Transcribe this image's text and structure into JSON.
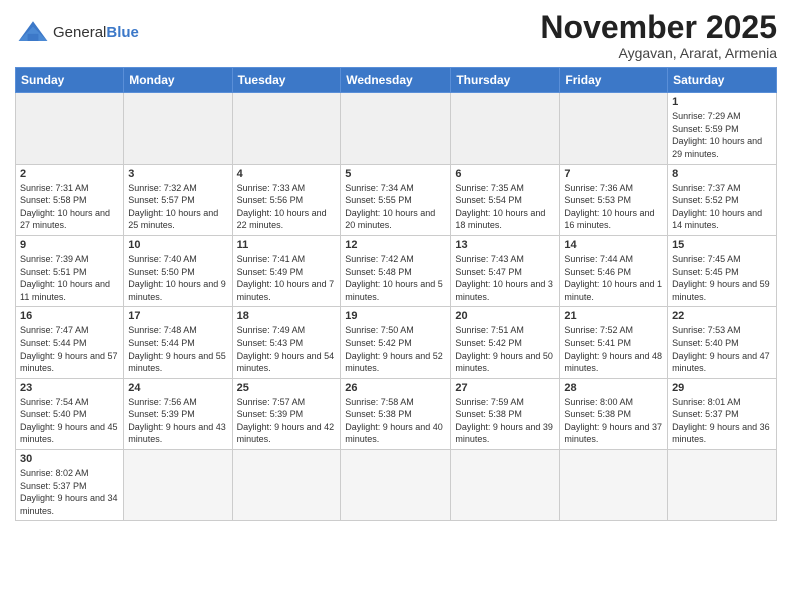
{
  "logo": {
    "text_general": "General",
    "text_blue": "Blue"
  },
  "title": "November 2025",
  "subtitle": "Aygavan, Ararat, Armenia",
  "weekdays": [
    "Sunday",
    "Monday",
    "Tuesday",
    "Wednesday",
    "Thursday",
    "Friday",
    "Saturday"
  ],
  "weeks": [
    [
      {
        "day": "",
        "info": ""
      },
      {
        "day": "",
        "info": ""
      },
      {
        "day": "",
        "info": ""
      },
      {
        "day": "",
        "info": ""
      },
      {
        "day": "",
        "info": ""
      },
      {
        "day": "",
        "info": ""
      },
      {
        "day": "1",
        "info": "Sunrise: 7:29 AM\nSunset: 5:59 PM\nDaylight: 10 hours and 29 minutes."
      }
    ],
    [
      {
        "day": "2",
        "info": "Sunrise: 7:31 AM\nSunset: 5:58 PM\nDaylight: 10 hours and 27 minutes."
      },
      {
        "day": "3",
        "info": "Sunrise: 7:32 AM\nSunset: 5:57 PM\nDaylight: 10 hours and 25 minutes."
      },
      {
        "day": "4",
        "info": "Sunrise: 7:33 AM\nSunset: 5:56 PM\nDaylight: 10 hours and 22 minutes."
      },
      {
        "day": "5",
        "info": "Sunrise: 7:34 AM\nSunset: 5:55 PM\nDaylight: 10 hours and 20 minutes."
      },
      {
        "day": "6",
        "info": "Sunrise: 7:35 AM\nSunset: 5:54 PM\nDaylight: 10 hours and 18 minutes."
      },
      {
        "day": "7",
        "info": "Sunrise: 7:36 AM\nSunset: 5:53 PM\nDaylight: 10 hours and 16 minutes."
      },
      {
        "day": "8",
        "info": "Sunrise: 7:37 AM\nSunset: 5:52 PM\nDaylight: 10 hours and 14 minutes."
      }
    ],
    [
      {
        "day": "9",
        "info": "Sunrise: 7:39 AM\nSunset: 5:51 PM\nDaylight: 10 hours and 11 minutes."
      },
      {
        "day": "10",
        "info": "Sunrise: 7:40 AM\nSunset: 5:50 PM\nDaylight: 10 hours and 9 minutes."
      },
      {
        "day": "11",
        "info": "Sunrise: 7:41 AM\nSunset: 5:49 PM\nDaylight: 10 hours and 7 minutes."
      },
      {
        "day": "12",
        "info": "Sunrise: 7:42 AM\nSunset: 5:48 PM\nDaylight: 10 hours and 5 minutes."
      },
      {
        "day": "13",
        "info": "Sunrise: 7:43 AM\nSunset: 5:47 PM\nDaylight: 10 hours and 3 minutes."
      },
      {
        "day": "14",
        "info": "Sunrise: 7:44 AM\nSunset: 5:46 PM\nDaylight: 10 hours and 1 minute."
      },
      {
        "day": "15",
        "info": "Sunrise: 7:45 AM\nSunset: 5:45 PM\nDaylight: 9 hours and 59 minutes."
      }
    ],
    [
      {
        "day": "16",
        "info": "Sunrise: 7:47 AM\nSunset: 5:44 PM\nDaylight: 9 hours and 57 minutes."
      },
      {
        "day": "17",
        "info": "Sunrise: 7:48 AM\nSunset: 5:44 PM\nDaylight: 9 hours and 55 minutes."
      },
      {
        "day": "18",
        "info": "Sunrise: 7:49 AM\nSunset: 5:43 PM\nDaylight: 9 hours and 54 minutes."
      },
      {
        "day": "19",
        "info": "Sunrise: 7:50 AM\nSunset: 5:42 PM\nDaylight: 9 hours and 52 minutes."
      },
      {
        "day": "20",
        "info": "Sunrise: 7:51 AM\nSunset: 5:42 PM\nDaylight: 9 hours and 50 minutes."
      },
      {
        "day": "21",
        "info": "Sunrise: 7:52 AM\nSunset: 5:41 PM\nDaylight: 9 hours and 48 minutes."
      },
      {
        "day": "22",
        "info": "Sunrise: 7:53 AM\nSunset: 5:40 PM\nDaylight: 9 hours and 47 minutes."
      }
    ],
    [
      {
        "day": "23",
        "info": "Sunrise: 7:54 AM\nSunset: 5:40 PM\nDaylight: 9 hours and 45 minutes."
      },
      {
        "day": "24",
        "info": "Sunrise: 7:56 AM\nSunset: 5:39 PM\nDaylight: 9 hours and 43 minutes."
      },
      {
        "day": "25",
        "info": "Sunrise: 7:57 AM\nSunset: 5:39 PM\nDaylight: 9 hours and 42 minutes."
      },
      {
        "day": "26",
        "info": "Sunrise: 7:58 AM\nSunset: 5:38 PM\nDaylight: 9 hours and 40 minutes."
      },
      {
        "day": "27",
        "info": "Sunrise: 7:59 AM\nSunset: 5:38 PM\nDaylight: 9 hours and 39 minutes."
      },
      {
        "day": "28",
        "info": "Sunrise: 8:00 AM\nSunset: 5:38 PM\nDaylight: 9 hours and 37 minutes."
      },
      {
        "day": "29",
        "info": "Sunrise: 8:01 AM\nSunset: 5:37 PM\nDaylight: 9 hours and 36 minutes."
      }
    ],
    [
      {
        "day": "30",
        "info": "Sunrise: 8:02 AM\nSunset: 5:37 PM\nDaylight: 9 hours and 34 minutes."
      },
      {
        "day": "",
        "info": ""
      },
      {
        "day": "",
        "info": ""
      },
      {
        "day": "",
        "info": ""
      },
      {
        "day": "",
        "info": ""
      },
      {
        "day": "",
        "info": ""
      },
      {
        "day": "",
        "info": ""
      }
    ]
  ]
}
